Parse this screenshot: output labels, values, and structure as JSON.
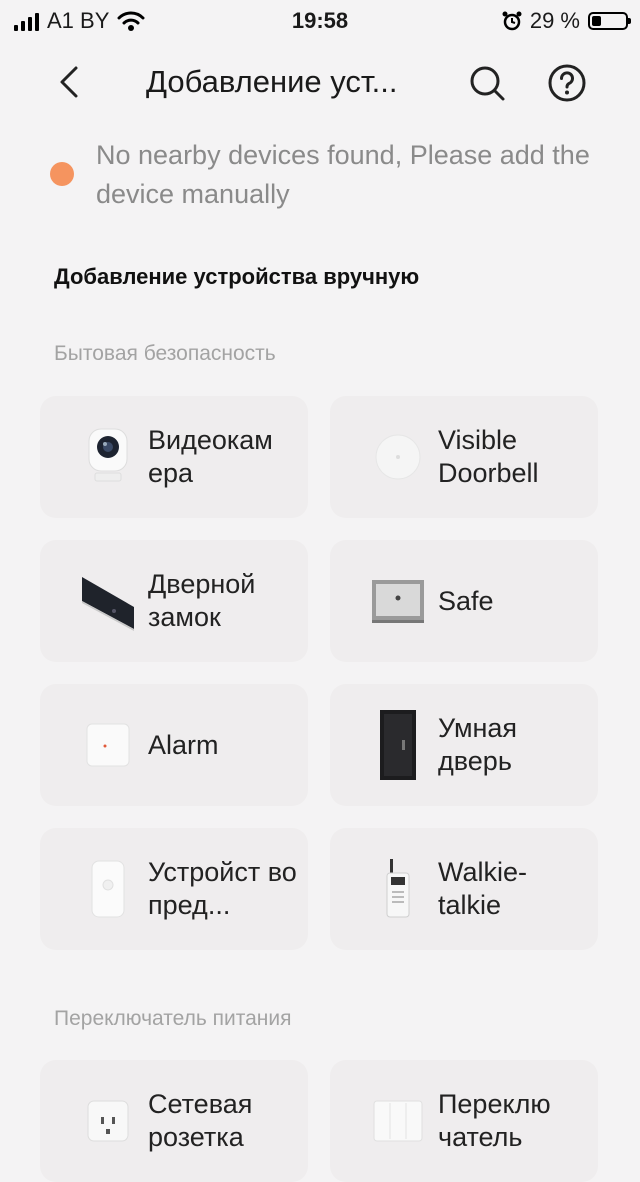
{
  "status_bar": {
    "carrier": "A1 BY",
    "time": "19:58",
    "battery_percent": "29 %",
    "battery_level": 0.29
  },
  "nav": {
    "title": "Добавление уст..."
  },
  "notice": {
    "text": "No nearby devices found, Please add the device manually",
    "dot_color": "#f5945f"
  },
  "section_title": "Добавление устройства вручную",
  "categories": [
    {
      "name": "Бытовая безопасность",
      "devices": [
        {
          "label": "Видеокам ера",
          "icon": "camera-icon"
        },
        {
          "label": "Visible Doorbell",
          "icon": "doorbell-icon"
        },
        {
          "label": "Дверной замок",
          "icon": "door-lock-icon"
        },
        {
          "label": "Safe",
          "icon": "safe-icon"
        },
        {
          "label": "Alarm",
          "icon": "alarm-icon"
        },
        {
          "label": "Умная дверь",
          "icon": "smart-door-icon"
        },
        {
          "label": "Устройст во пред...",
          "icon": "sensor-icon"
        },
        {
          "label": "Walkie- talkie",
          "icon": "walkie-talkie-icon"
        }
      ]
    },
    {
      "name": "Переключатель питания",
      "devices": [
        {
          "label": "Сетевая розетка",
          "icon": "socket-icon"
        },
        {
          "label": "Переклю чатель",
          "icon": "switch-icon"
        }
      ]
    }
  ]
}
